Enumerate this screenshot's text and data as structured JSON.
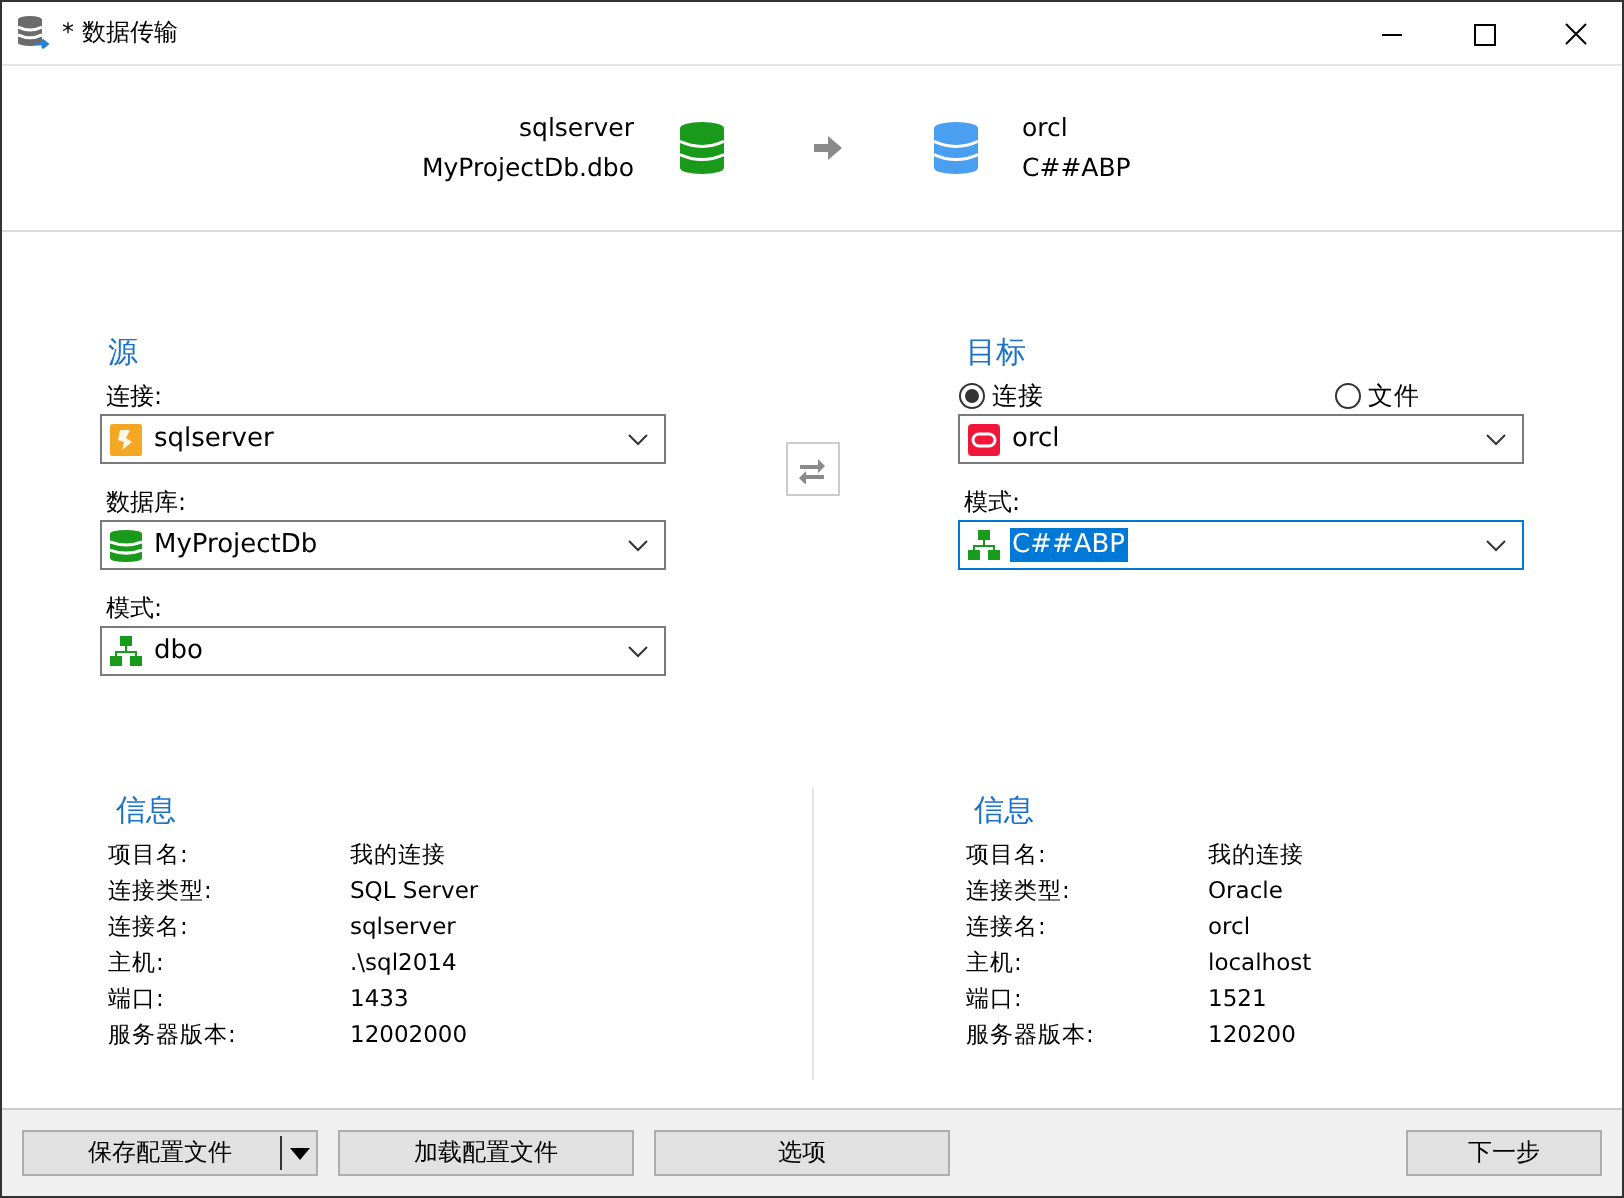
{
  "window": {
    "title": "* 数据传输"
  },
  "summary": {
    "source": {
      "connection": "sqlserver",
      "object": "MyProjectDb.dbo"
    },
    "target": {
      "connection": "orcl",
      "object": "C##ABP"
    }
  },
  "source": {
    "heading": "源",
    "fields": [
      {
        "label": "连接:",
        "value": "sqlserver",
        "kind": "server",
        "focused": false
      },
      {
        "label": "数据库:",
        "value": "MyProjectDb",
        "kind": "database",
        "focused": false
      },
      {
        "label": "模式:",
        "value": "dbo",
        "kind": "schema",
        "focused": false
      }
    ]
  },
  "target": {
    "heading": "目标",
    "modes": [
      {
        "label": "连接",
        "selected": true
      },
      {
        "label": "文件",
        "selected": false
      }
    ],
    "fields": [
      {
        "value": "orcl",
        "kind": "oracle",
        "focused": false
      },
      {
        "label": "模式:",
        "value": "C##ABP",
        "kind": "schema",
        "focused": true
      }
    ]
  },
  "info": [
    {
      "heading": "信息",
      "rows": [
        {
          "label": "项目名:",
          "value": "我的连接"
        },
        {
          "label": "连接类型:",
          "value": "SQL Server"
        },
        {
          "label": "连接名:",
          "value": "sqlserver"
        },
        {
          "label": "主机:",
          "value": ".\\sql2014"
        },
        {
          "label": "端口:",
          "value": "1433"
        },
        {
          "label": "服务器版本:",
          "value": "12002000"
        }
      ]
    },
    {
      "heading": "信息",
      "rows": [
        {
          "label": "项目名:",
          "value": "我的连接"
        },
        {
          "label": "连接类型:",
          "value": "Oracle"
        },
        {
          "label": "连接名:",
          "value": "orcl"
        },
        {
          "label": "主机:",
          "value": "localhost"
        },
        {
          "label": "端口:",
          "value": "1521"
        },
        {
          "label": "服务器版本:",
          "value": "120200"
        }
      ]
    }
  ],
  "buttons": [
    {
      "label": "保存配置文件",
      "kind": "split"
    },
    {
      "label": "加载配置文件",
      "kind": "plain"
    },
    {
      "label": "选项",
      "kind": "plain"
    },
    {
      "label": "下一步",
      "kind": "plain"
    }
  ]
}
